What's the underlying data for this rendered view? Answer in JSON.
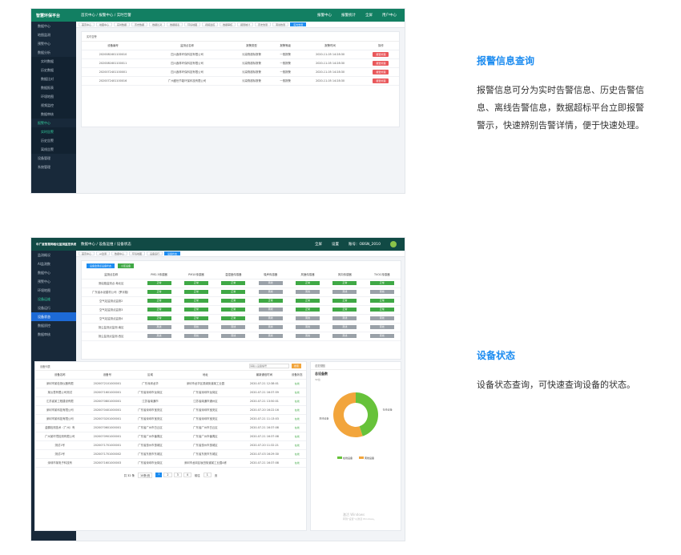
{
  "section1": {
    "heading": "报警信息查询",
    "description": "报警信息可分为实时告警信息、历史告警信息、离线告警信息，数据超标平台立即报警警示，快速辨别告警详情，便于快速处理。"
  },
  "section2": {
    "heading": "设备状态",
    "description": "设备状态查询，可快速查询设备的状态。"
  },
  "shot1": {
    "logo": "智慧环保平台",
    "breadcrumb": "首页中心 / 报警中心 / 实时告警",
    "header_right": [
      "报警中心",
      "报警统计",
      "全屏",
      "用户中心"
    ],
    "panel_title": "实时告警",
    "columns": [
      "设备编号",
      "监测点名称",
      "报警类型",
      "报警等级",
      "报警时间",
      "操作"
    ],
    "rows": [
      {
        "id": "2020081601100010",
        "name": "四川鑫林环保科技有限公司",
        "type": "污染物超标报警",
        "level": "一般报警",
        "time": "2020-11-05 14:28:30",
        "op": "报警处理"
      },
      {
        "id": "2020081601100011",
        "name": "四川鑫林环保科技有限公司",
        "type": "污染物超标报警",
        "level": "一般报警",
        "time": "2020-11-05 14:28:30",
        "op": "报警处理"
      },
      {
        "id": "2020072401100001",
        "name": "四川鑫林环保科技有限公司",
        "type": "污染物超标报警",
        "level": "一般报警",
        "time": "2020-11-05 14:28:30",
        "op": "报警处理"
      },
      {
        "id": "2020072401100016",
        "name": "广州盛世节能环保科技有限公司",
        "type": "污染物超标报警",
        "level": "一般报警",
        "time": "2020-11-05 14:28:30",
        "op": "报警处理"
      }
    ],
    "sidebar": [
      "数据中心",
      "地图监测",
      "预警中心",
      "数据分析",
      "实时数据",
      "历史数据",
      "数据比对",
      "数据报表",
      "环境地图",
      "视频监控",
      "数据审核",
      "报警中心",
      "实时告警",
      "历史告警",
      "离线告警",
      "设备管理",
      "系统管理"
    ]
  },
  "shot2": {
    "logo": "中广星智慧网格化监测监控系统",
    "breadcrumb": "数据中心 / 设备运维 / 设备状态",
    "header_right": [
      "全屏",
      "设置",
      "账号：OBSN_2010"
    ],
    "toolbar_buttons": [
      "设备监测点设备状态",
      "小区设备"
    ],
    "status_columns": [
      "监测点名称",
      "PM2.5传感器",
      "PM10传感器",
      "温湿度传感器",
      "噪声传感器",
      "风速传感器",
      "风向传感器",
      "TVOC传感器"
    ],
    "status_rows": [
      {
        "name": "测绘路监测点-粤北区",
        "states": [
          "正常",
          "正常",
          "正常",
          "离线",
          "正常",
          "正常",
          "正常"
        ]
      },
      {
        "name": "广东省水泥建材公司（罗浮路）",
        "states": [
          "正常",
          "正常",
          "正常",
          "离线",
          "离线",
          "离线",
          "离线"
        ]
      },
      {
        "name": "空气站监测点监测2",
        "states": [
          "正常",
          "正常",
          "正常",
          "正常",
          "正常",
          "正常",
          "正常"
        ]
      },
      {
        "name": "空气站监测点监测3",
        "states": [
          "正常",
          "正常",
          "正常",
          "离线",
          "正常",
          "正常",
          "正常"
        ]
      },
      {
        "name": "空气站监测点监测4",
        "states": [
          "正常",
          "正常",
          "正常",
          "离线",
          "离线",
          "离线",
          "离线"
        ]
      },
      {
        "name": "扬尘监测点监测-南区",
        "states": [
          "离线",
          "离线",
          "离线",
          "离线",
          "离线",
          "离线",
          "离线"
        ]
      },
      {
        "name": "扬尘监测点监测-西区",
        "states": [
          "离线",
          "离线",
          "离线",
          "离线",
          "离线",
          "离线",
          "离线"
        ]
      }
    ],
    "device_panel_title": "设备列表",
    "search_placeholder": "请输入设备编号",
    "search_button": "搜索",
    "device_columns": [
      "设备名称",
      "设备号",
      "区域",
      "地址",
      "最新通信时间",
      "设备状态"
    ],
    "devices": [
      {
        "name": "深圳市某检测仪器有限",
        "no": "2020072101000001",
        "area": "广东深圳龙华",
        "addr": "深圳市龙华区观澜街道某工业园",
        "time": "2020-07-21 12:38:01",
        "status": "在线"
      },
      {
        "name": "某仪表有限公司测试",
        "no": "2020071601000001",
        "area": "广东省深圳市龙岗区",
        "addr": "广东省深圳市龙岗区",
        "time": "2020-07-21 16:37:59",
        "status": "在线"
      },
      {
        "name": "江苏省某工程建设有限",
        "no": "2020070801000001",
        "area": "江苏省南通市",
        "addr": "江苏省南通市通州区",
        "time": "2020-07-21 13:50:01",
        "status": "在线"
      },
      {
        "name": "深圳市某科技有限公司",
        "no": "2020070401000001",
        "area": "广东省深圳市宝安区",
        "addr": "广东省深圳市宝安区",
        "time": "2020-07-20 16:22:16",
        "status": "在线"
      },
      {
        "name": "深圳市某科技有限公司",
        "no": "2020070201000001",
        "area": "广东省深圳市宝安区",
        "addr": "广东省深圳市宝安区",
        "time": "2020-07-21 11:13:03",
        "status": "在线"
      },
      {
        "name": "金鹏检测技术（广州）有",
        "no": "2020070601000001",
        "area": "广东省广州市白云区",
        "addr": "广东省广州市白云区",
        "time": "2020-07-21 16:37:08",
        "status": "在线"
      },
      {
        "name": "广州某环境检测有限公司",
        "no": "2020070901000001",
        "area": "广东省广州市番禺区",
        "addr": "广东省广州市番禺区",
        "time": "2020-07-21 16:37:08",
        "status": "在线"
      },
      {
        "name": "测试1号",
        "no": "2020071701000001",
        "area": "广东省惠州市惠城区",
        "addr": "广东省惠州市惠城区",
        "time": "2020-07-20 11:32:21",
        "status": "在线"
      },
      {
        "name": "测试2号",
        "no": "2020071701000002",
        "area": "广东省东莞市东城区",
        "addr": "广东省东莞市东城区",
        "time": "2020-07-03 16:29:30",
        "status": "在线"
      },
      {
        "name": "深圳市某电子科技有",
        "no": "2020071601000003",
        "area": "广东省深圳市龙岗区",
        "addr": "深圳市龙岗区坂田街道某工业园A栋",
        "time": "2020-07-21 16:37:08",
        "status": "在线"
      }
    ],
    "pagination": {
      "total": "共 32 条",
      "page_size": "10条/页",
      "pages": [
        "1",
        "2",
        "3",
        "4"
      ],
      "current": "1",
      "goto": "前往",
      "goto_page": "1",
      "goto_suffix": "页"
    },
    "overview_title": "总览视图",
    "overview_subtitle": "总设备数",
    "overview_count": "32台",
    "donut_labels": [
      "在线设备",
      "离线设备"
    ],
    "legend": [
      "在线设备",
      "离线设备"
    ],
    "watermark_line1": "激活 Windows",
    "watermark_line2": "转到“设置”以激活 Windows。",
    "sidebar": [
      "监测概况",
      "AI监测数",
      "数据中心",
      "预警中心",
      "环境地图",
      "设备运维",
      "设备运行",
      "设备状态",
      "数据质控",
      "数据审核"
    ]
  },
  "chart_data": {
    "type": "pie",
    "categories": [
      "在线设备",
      "离线设备"
    ],
    "values": [
      45,
      55
    ],
    "colors": [
      "#67c23a",
      "#f2a53c"
    ]
  }
}
